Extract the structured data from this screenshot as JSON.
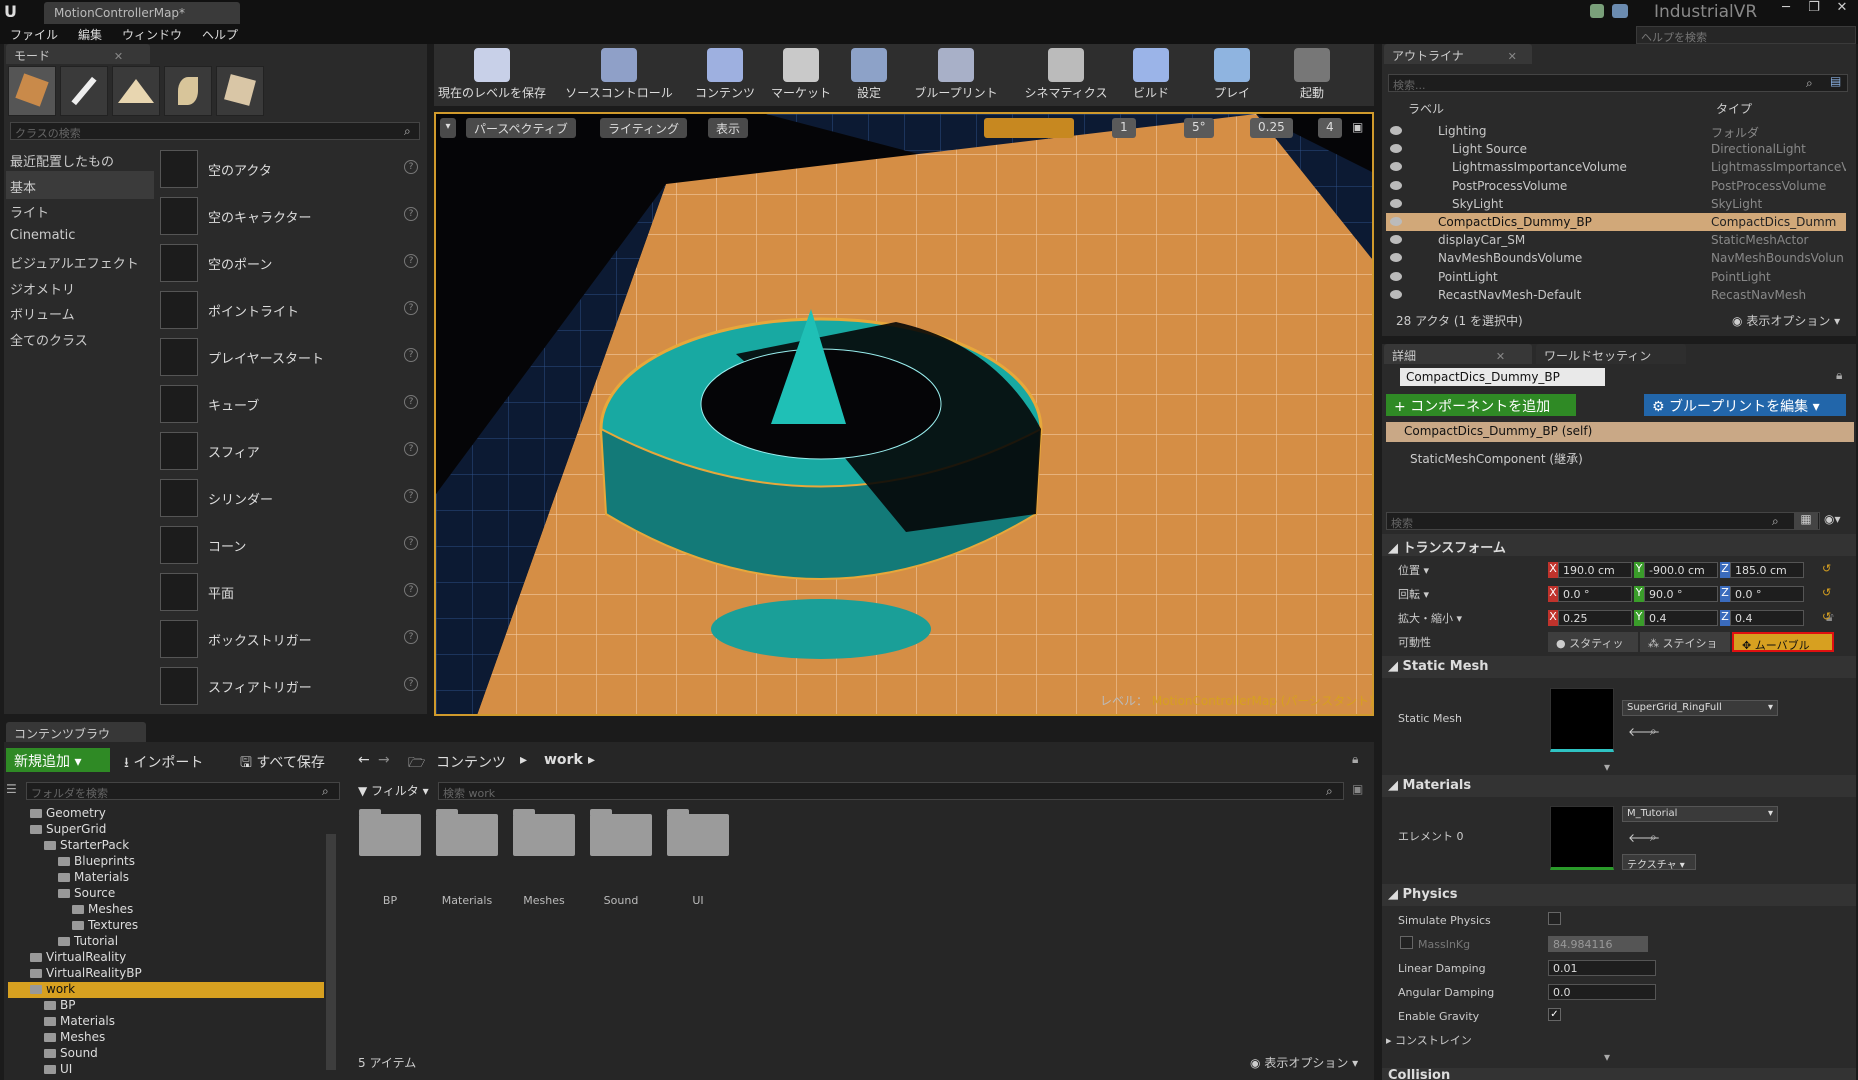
{
  "window": {
    "tab_title": "MotionControllerMap*",
    "project": "IndustrialVR",
    "help_search_placeholder": "ヘルプを検索"
  },
  "menu": [
    "ファイル",
    "編集",
    "ウィンドウ",
    "ヘルプ"
  ],
  "modes": {
    "tab": "モード",
    "search_placeholder": "クラスの検索",
    "categories": [
      "最近配置したもの",
      "基本",
      "ライト",
      "Cinematic",
      "ビジュアルエフェクト",
      "ジオメトリ",
      "ボリューム",
      "全てのクラス"
    ],
    "selected_category": "基本",
    "classes": [
      "空のアクタ",
      "空のキャラクター",
      "空のポーン",
      "ポイントライト",
      "プレイヤースタート",
      "キューブ",
      "スフィア",
      "シリンダー",
      "コーン",
      "平面",
      "ボックストリガー",
      "スフィアトリガー"
    ]
  },
  "toolbar": [
    {
      "label": "現在のレベルを保存",
      "color": "#c8d0e8"
    },
    {
      "label": "ソースコントロール",
      "color": "#8fa0c8"
    },
    {
      "label": "コンテンツ",
      "color": "#9eb0e0"
    },
    {
      "label": "マーケット",
      "color": "#c9c9c9"
    },
    {
      "label": "設定",
      "color": "#8da2c8"
    },
    {
      "label": "ブループリント",
      "color": "#a8b0c8"
    },
    {
      "label": "シネマティクス",
      "color": "#bbbbbb"
    },
    {
      "label": "ビルド",
      "color": "#9bb4e8"
    },
    {
      "label": "プレイ",
      "color": "#8fb4e0"
    },
    {
      "label": "起動",
      "color": "#777777"
    }
  ],
  "viewport": {
    "perspective": "パースペクティブ",
    "lighting": "ライティング",
    "show": "表示",
    "snap_grid": "1",
    "snap_angle": "5°",
    "snap_scale": "0.25",
    "camera_speed": "4",
    "level_prefix": "レベル：",
    "level_name": "MotionControllerMap (パーシスタント)"
  },
  "outliner": {
    "tab": "アウトライナ",
    "search_placeholder": "検索...",
    "col_label": "ラベル",
    "col_type": "タイプ",
    "rows": [
      {
        "label": "Lighting",
        "type": "フォルダ",
        "indent": 1
      },
      {
        "label": "Light Source",
        "type": "DirectionalLight",
        "indent": 2
      },
      {
        "label": "LightmassImportanceVolume",
        "type": "LightmassImportanceV",
        "indent": 2
      },
      {
        "label": "PostProcessVolume",
        "type": "PostProcessVolume",
        "indent": 2
      },
      {
        "label": "SkyLight",
        "type": "SkyLight",
        "indent": 2
      },
      {
        "label": "CompactDics_Dummy_BP",
        "type": "CompactDics_Dumm",
        "indent": 1,
        "selected": true
      },
      {
        "label": "displayCar_SM",
        "type": "StaticMeshActor",
        "indent": 1
      },
      {
        "label": "NavMeshBoundsVolume",
        "type": "NavMeshBoundsVolun",
        "indent": 1
      },
      {
        "label": "PointLight",
        "type": "PointLight",
        "indent": 1
      },
      {
        "label": "RecastNavMesh-Default",
        "type": "RecastNavMesh",
        "indent": 1
      }
    ],
    "count": "28 アクタ (1 を選択中)",
    "view_options": "表示オプション"
  },
  "details": {
    "tab": "詳細",
    "tab2": "ワールドセッティン",
    "object_name": "CompactDics_Dummy_BP",
    "add_component": "+ コンポーネントを追加",
    "edit_blueprint": "ブループリントを編集",
    "component_self": "CompactDics_Dummy_BP (self)",
    "component_child": "StaticMeshComponent (継承)",
    "search_placeholder": "検索",
    "transform": {
      "title": "トランスフォーム",
      "location_label": "位置",
      "rotation_label": "回転",
      "scale_label": "拡大・縮小",
      "mobility_label": "可動性",
      "location": [
        "190.0 cm",
        "-900.0 cm",
        "185.0 cm"
      ],
      "rotation": [
        "0.0 °",
        "90.0 °",
        "0.0 °"
      ],
      "scale": [
        "0.25",
        "0.4",
        "0.4"
      ],
      "mobility_options": [
        "スタティッ",
        "ステイショ",
        "ムーバブル"
      ]
    },
    "static_mesh": {
      "title": "Static Mesh",
      "label": "Static Mesh",
      "value": "SuperGrid_RingFull"
    },
    "materials": {
      "title": "Materials",
      "label": "エレメント 0",
      "value": "M_Tutorial",
      "texture_btn": "テクスチャ"
    },
    "physics": {
      "title": "Physics",
      "simulate": "Simulate Physics",
      "mass_label": "MassInKg",
      "mass": "84.984116",
      "linear_label": "Linear Damping",
      "linear": "0.01",
      "angular_label": "Angular Damping",
      "angular": "0.0",
      "gravity_label": "Enable Gravity",
      "constraints": "コンストレイン"
    },
    "collision": "Collision"
  },
  "content_browser": {
    "tab": "コンテンツブラウ",
    "new": "新規追加",
    "import": "インポート",
    "save_all": "すべて保存",
    "path_root": "コンテンツ",
    "path_child": "work",
    "folder_search_placeholder": "フォルダを検索",
    "filter": "フィルタ",
    "search_placeholder": "検索 work",
    "tree": [
      {
        "label": "Geometry",
        "indent": 1
      },
      {
        "label": "SuperGrid",
        "indent": 1
      },
      {
        "label": "StarterPack",
        "indent": 2
      },
      {
        "label": "Blueprints",
        "indent": 3
      },
      {
        "label": "Materials",
        "indent": 3
      },
      {
        "label": "Source",
        "indent": 3
      },
      {
        "label": "Meshes",
        "indent": 4
      },
      {
        "label": "Textures",
        "indent": 4
      },
      {
        "label": "Tutorial",
        "indent": 3
      },
      {
        "label": "VirtualReality",
        "indent": 1
      },
      {
        "label": "VirtualRealityBP",
        "indent": 1
      },
      {
        "label": "work",
        "indent": 1,
        "selected": true
      },
      {
        "label": "BP",
        "indent": 2
      },
      {
        "label": "Materials",
        "indent": 2
      },
      {
        "label": "Meshes",
        "indent": 2
      },
      {
        "label": "Sound",
        "indent": 2
      },
      {
        "label": "UI",
        "indent": 2
      }
    ],
    "assets": [
      "BP",
      "Materials",
      "Meshes",
      "Sound",
      "UI"
    ],
    "item_count": "5 アイテム",
    "view_options": "表示オプション"
  },
  "colors": {
    "accent_orange": "#d7a020",
    "green": "#2f8a25",
    "blue": "#2266aa",
    "teal": "#1fb3aa",
    "floor": "#d58e45"
  }
}
